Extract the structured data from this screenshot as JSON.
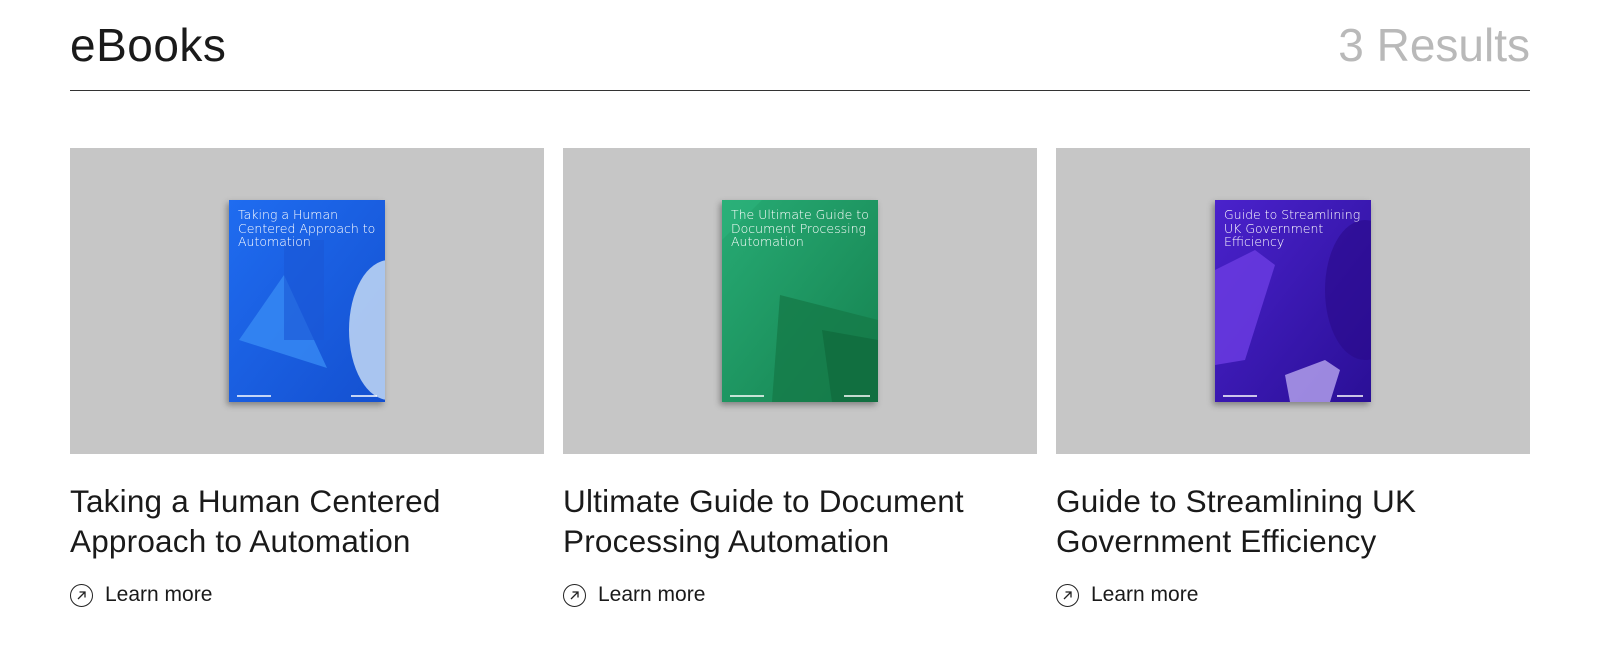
{
  "header": {
    "title": "eBooks",
    "results": "3 Results"
  },
  "cards": [
    {
      "cover_title": "Taking a Human Centered Approach to Automation",
      "title": "Taking a Human Centered Approach to Automation",
      "link": "Learn more",
      "cover_color": "#1a5ce0"
    },
    {
      "cover_title": "The Ultimate Guide to Document Processing Automation",
      "title": "Ultimate Guide to Document Processing Automation",
      "link": "Learn more",
      "cover_color": "#1f9a66"
    },
    {
      "cover_title": "Guide to Streamlining UK Government Efficiency",
      "title": "Guide to Streamlining UK Government Efficiency",
      "link": "Learn more",
      "cover_color": "#3b1bb8"
    }
  ],
  "icons": {
    "learn_more": "arrow-up-right-circle-icon"
  }
}
